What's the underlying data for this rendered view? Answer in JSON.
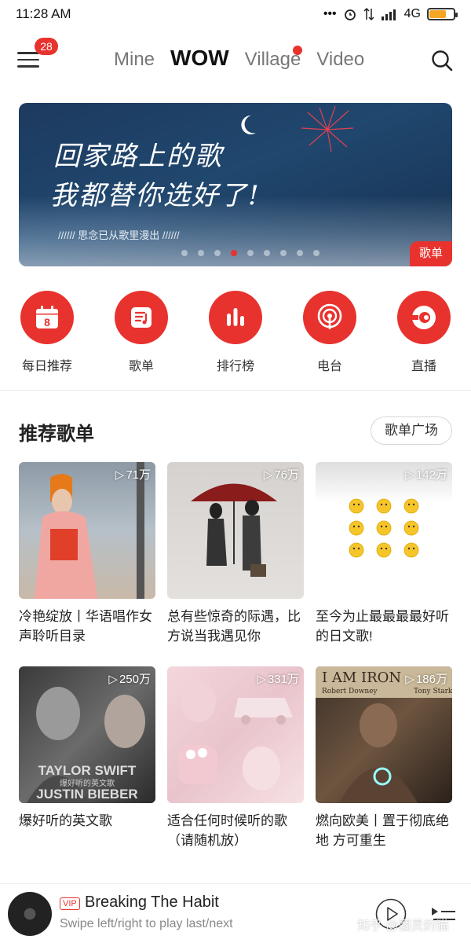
{
  "status": {
    "time": "11:28 AM",
    "network": "4G",
    "battery_level": 0.7
  },
  "header": {
    "badge_count": "28",
    "tabs": [
      {
        "label": "Mine",
        "active": false
      },
      {
        "label": "WOW",
        "active": true
      },
      {
        "label": "Village",
        "active": false,
        "has_dot": true
      },
      {
        "label": "Video",
        "active": false
      }
    ]
  },
  "banner": {
    "title_line1": "回家路上的歌",
    "title_line2": "我都替你选好了!",
    "subtitle": "////// 思念已从歌里漫出 //////",
    "tag": "歌单",
    "page_count": 9,
    "active_page": 3
  },
  "quick_nav": [
    {
      "label": "每日推荐",
      "icon": "calendar-icon",
      "day": "8"
    },
    {
      "label": "歌单",
      "icon": "playlist-icon"
    },
    {
      "label": "排行榜",
      "icon": "chart-bars-icon"
    },
    {
      "label": "电台",
      "icon": "radio-icon"
    },
    {
      "label": "直播",
      "icon": "live-icon"
    }
  ],
  "section": {
    "title": "推荐歌单",
    "more_button": "歌单广场"
  },
  "playlists": [
    {
      "plays": "71万",
      "title": "冷艳绽放丨华语唱作女声聆听目录"
    },
    {
      "plays": "76万",
      "title": "总有些惊奇的际遇，比方说当我遇见你"
    },
    {
      "plays": "142万",
      "title": "至今为止最最最最好听的日文歌!"
    },
    {
      "plays": "250万",
      "title": "爆好听的英文歌",
      "cover_text_1": "TAYLOR SWIFT",
      "cover_text_2": "爆好听的英文歌",
      "cover_text_3": "JUSTIN BIEBER"
    },
    {
      "plays": "331万",
      "title": "适合任何时候听的歌（请随机放）"
    },
    {
      "plays": "186万",
      "title": "燃向欧美丨置于彻底绝地 方可重生",
      "cover_text_1": "I AM IRON",
      "cover_text_2": "Robert Downey",
      "cover_text_3": "Tony Stark"
    }
  ],
  "player": {
    "vip": "VIP",
    "song": "Breaking The Habit",
    "hint": "Swipe left/right to play last/next"
  },
  "watermark": "知乎 @图灵的猫",
  "colors": {
    "accent": "#e8322e"
  }
}
